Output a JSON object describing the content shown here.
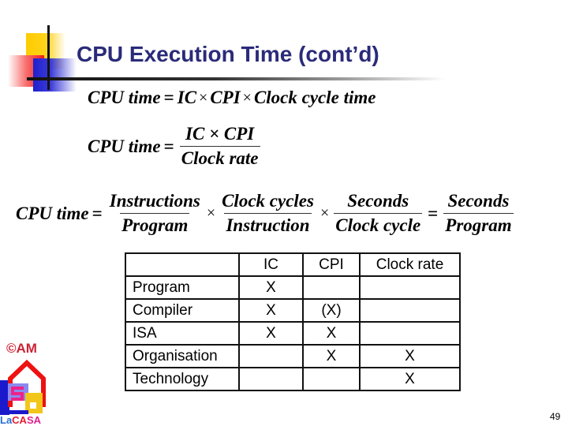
{
  "slide": {
    "title": "CPU Execution Time (cont’d)",
    "page_number": "49"
  },
  "formulas": {
    "f1": {
      "lhs": "CPU time",
      "eq": "=",
      "terms": [
        "IC",
        "CPI",
        "Clock cycle time"
      ],
      "times": "×"
    },
    "f2": {
      "lhs": "CPU time",
      "eq": "=",
      "numerator": "IC × CPI",
      "denominator": "Clock rate"
    },
    "f3": {
      "lhs": "CPU time",
      "eq": "=",
      "times": "×",
      "fractions": [
        {
          "num": "Instructions",
          "den": "Program"
        },
        {
          "num": "Clock cycles",
          "den": "Instruction"
        },
        {
          "num": "Seconds",
          "den": "Clock cycle"
        }
      ],
      "result": {
        "num": "Seconds",
        "den": "Program"
      }
    }
  },
  "table": {
    "headers": [
      "",
      "IC",
      "CPI",
      "Clock rate"
    ],
    "rows": [
      [
        "Program",
        "X",
        "",
        ""
      ],
      [
        "Compiler",
        "X",
        "(X)",
        ""
      ],
      [
        "ISA",
        "X",
        "X",
        ""
      ],
      [
        "Organisation",
        "",
        "X",
        "X"
      ],
      [
        "Technology",
        "",
        "",
        "X"
      ]
    ]
  },
  "logo": {
    "copyright": "©AM",
    "text_parts": [
      "La",
      "CA",
      "SA"
    ],
    "colors": [
      "#2a6fd6",
      "#e02030",
      "#e02090"
    ]
  },
  "colors": {
    "title": "#2b2b7a"
  }
}
